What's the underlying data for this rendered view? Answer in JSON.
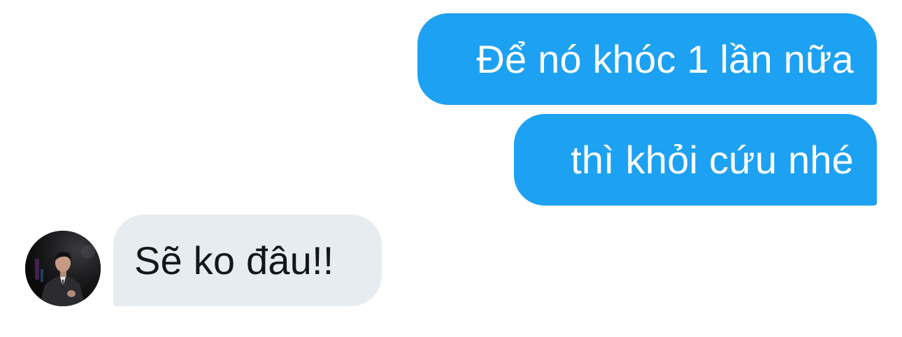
{
  "conversation": {
    "messages": [
      {
        "sender": "me",
        "text": "Để nó khóc 1 lần nữa"
      },
      {
        "sender": "me",
        "text": "thì khỏi cứu nhé"
      },
      {
        "sender": "other",
        "text": "Sẽ ko đâu!!"
      }
    ]
  },
  "colors": {
    "outgoing_bubble": "#1da1f2",
    "outgoing_text": "#ffffff",
    "incoming_bubble": "#e6ecf0",
    "incoming_text": "#14171a",
    "background": "#ffffff"
  },
  "icons": {
    "avatar": "profile-photo-avatar"
  }
}
